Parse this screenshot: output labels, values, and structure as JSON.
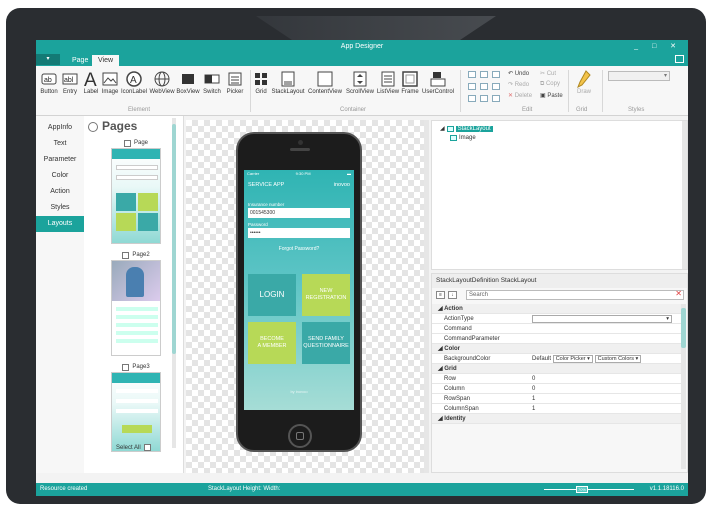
{
  "window": {
    "title": "App Designer",
    "controls": "_ □ ✕"
  },
  "menu": {
    "tabs": [
      "Page",
      "View"
    ]
  },
  "ribbon": {
    "element_buttons": [
      "Button",
      "Entry",
      "Label",
      "Image",
      "IconLabel",
      "WebView",
      "BoxView",
      "Switch",
      "Picker"
    ],
    "container_buttons": [
      "Grid",
      "StackLayout",
      "ContentView",
      "ScrollView",
      "ListView",
      "Frame",
      "UserControl"
    ],
    "groups": {
      "element": "Element",
      "container": "Container",
      "edit": "Edit",
      "grid": "Grid",
      "styles": "Styles"
    },
    "edit": {
      "undo": "Undo",
      "redo": "Redo",
      "delete": "Delete",
      "cut": "Cut",
      "copy": "Copy",
      "paste": "Paste"
    },
    "draw": "Draw"
  },
  "nav": {
    "items": [
      "AppInfo",
      "Text",
      "Parameter",
      "Color",
      "Action",
      "Styles",
      "Layouts"
    ],
    "active": "Layouts"
  },
  "pages": {
    "heading": "Pages",
    "items": [
      "Page",
      "Page2",
      "Page3"
    ],
    "select_all": "Select All"
  },
  "phone_app": {
    "status_left": "Carrier",
    "status_center": "9:30 PM",
    "app_title": "SERVICE APP",
    "app_brand": "inovoo",
    "field1_label": "Insurance number",
    "field1_value": "001545300",
    "field2_label": "Password",
    "field2_value": "••••••",
    "forgot": "Forgot Password?",
    "tiles": [
      "LOGIN",
      "NEW\nREGISTRATION",
      "BECOME\nA MEMBER",
      "SEND FAMILY\nQUESTIONNAIRE"
    ],
    "footer": "by inovoo"
  },
  "tree": {
    "root": "StackLayout",
    "child": "Image"
  },
  "properties": {
    "title": "StackLayoutDefinition",
    "title_type": "StackLayout",
    "search_placeholder": "Search",
    "sections": [
      {
        "name": "Action",
        "rows": [
          {
            "key": "ActionType",
            "value": ""
          },
          {
            "key": "Command",
            "value": ""
          },
          {
            "key": "CommandParameter",
            "value": ""
          }
        ]
      },
      {
        "name": "Color",
        "rows": [
          {
            "key": "BackgroundColor",
            "value": "Default",
            "picker": "Color Picker",
            "custom": "Custom Colors"
          }
        ]
      },
      {
        "name": "Grid",
        "rows": [
          {
            "key": "Row",
            "value": "0"
          },
          {
            "key": "Column",
            "value": "0"
          },
          {
            "key": "RowSpan",
            "value": "1"
          },
          {
            "key": "ColumnSpan",
            "value": "1"
          }
        ]
      },
      {
        "name": "Identity",
        "rows": []
      }
    ]
  },
  "status": {
    "left": "Resource created",
    "center": "StackLayout  Height:  Width:",
    "zoom": "70%",
    "version": "v1.1.18116.0"
  },
  "colors": {
    "accent": "#1ba39c",
    "tile_dark": "#3aa9a7",
    "tile_green": "#b7d957"
  }
}
